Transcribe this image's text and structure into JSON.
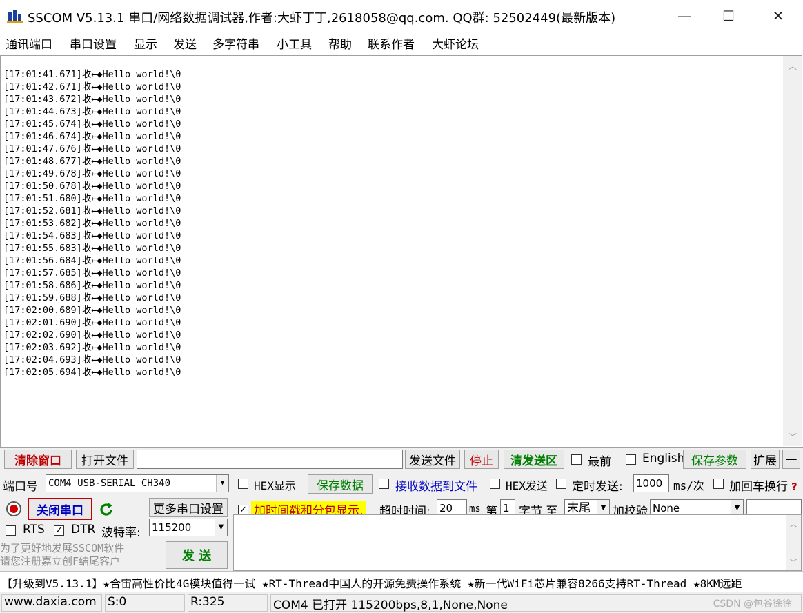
{
  "window": {
    "title": "SSCOM V5.13.1 串口/网络数据调试器,作者:大虾丁丁,2618058@qq.com. QQ群:  52502449(最新版本)",
    "minimize": "—",
    "maximize": "☐",
    "close": "✕"
  },
  "menu": [
    "通讯端口",
    "串口设置",
    "显示",
    "发送",
    "多字符串",
    "小工具",
    "帮助",
    "联系作者",
    "大虾论坛"
  ],
  "receive": {
    "lines": [
      "[17:01:41.671]收←◆Hello world!\\0",
      "[17:01:42.671]收←◆Hello world!\\0",
      "[17:01:43.672]收←◆Hello world!\\0",
      "[17:01:44.673]收←◆Hello world!\\0",
      "[17:01:45.674]收←◆Hello world!\\0",
      "[17:01:46.674]收←◆Hello world!\\0",
      "[17:01:47.676]收←◆Hello world!\\0",
      "[17:01:48.677]收←◆Hello world!\\0",
      "[17:01:49.678]收←◆Hello world!\\0",
      "[17:01:50.678]收←◆Hello world!\\0",
      "[17:01:51.680]收←◆Hello world!\\0",
      "[17:01:52.681]收←◆Hello world!\\0",
      "[17:01:53.682]收←◆Hello world!\\0",
      "[17:01:54.683]收←◆Hello world!\\0",
      "[17:01:55.683]收←◆Hello world!\\0",
      "[17:01:56.684]收←◆Hello world!\\0",
      "[17:01:57.685]收←◆Hello world!\\0",
      "[17:01:58.686]收←◆Hello world!\\0",
      "[17:01:59.688]收←◆Hello world!\\0",
      "[17:02:00.689]收←◆Hello world!\\0",
      "[17:02:01.690]收←◆Hello world!\\0",
      "[17:02:02.690]收←◆Hello world!\\0",
      "[17:02:03.692]收←◆Hello world!\\0",
      "[17:02:04.693]收←◆Hello world!\\0",
      "[17:02:05.694]收←◆Hello world!\\0"
    ]
  },
  "row1": {
    "clear_window": "清除窗口",
    "open_file": "打开文件",
    "file_path": "",
    "send_file": "发送文件",
    "stop": "停止",
    "clear_send": "清发送区",
    "topmost": "最前",
    "english": "English",
    "save_params": "保存参数",
    "expand": "扩展",
    "collapse": "—"
  },
  "row2": {
    "port_label": "端口号",
    "port_value": "COM4 USB-SERIAL CH340",
    "hex_display": "HEX显示",
    "save_data": "保存数据",
    "recv_to_file": "接收数据到文件",
    "hex_send": "HEX发送",
    "timed_send": "定时发送:",
    "interval_value": "1000",
    "interval_unit": "ms/次",
    "append_newline": "加回车换行",
    "help": "?"
  },
  "row3": {
    "close_port": "关闭串口",
    "more_settings": "更多串口设置",
    "timestamp_label": "加时间戳和分包显示,",
    "timeout_label": "超时时间:",
    "timeout_value": "20",
    "timeout_unit": "ms",
    "nth_label": "第",
    "nth_value": "1",
    "byte_label": "字节 至",
    "end_value": "末尾",
    "checksum_label": "加校验",
    "checksum_value": "None"
  },
  "row4": {
    "rts": "RTS",
    "dtr": "DTR",
    "baud_label": "波特率:",
    "baud_value": "115200"
  },
  "send_box": {
    "promo_line1": "为了更好地发展SSCOM软件",
    "promo_line2": "请您注册嘉立创F结尾客户",
    "send_button": "发  送",
    "text": ""
  },
  "ticker": "【升级到V5.13.1】★合宙高性价比4G模块值得一试 ★RT-Thread中国人的开源免费操作系统 ★新一代WiFi芯片兼容8266支持RT-Thread ★8KM远距",
  "status": {
    "website": "www.daxia.com",
    "sent": "S:0",
    "received": "R:325",
    "port_state": "COM4 已打开  115200bps,8,1,None,None",
    "watermark": "CSDN @包谷徐徐"
  },
  "colors": {
    "accent_red": "#c00000",
    "accent_green": "#008000",
    "accent_blue": "#0000c0",
    "highlight_yellow": "#ffff00"
  }
}
